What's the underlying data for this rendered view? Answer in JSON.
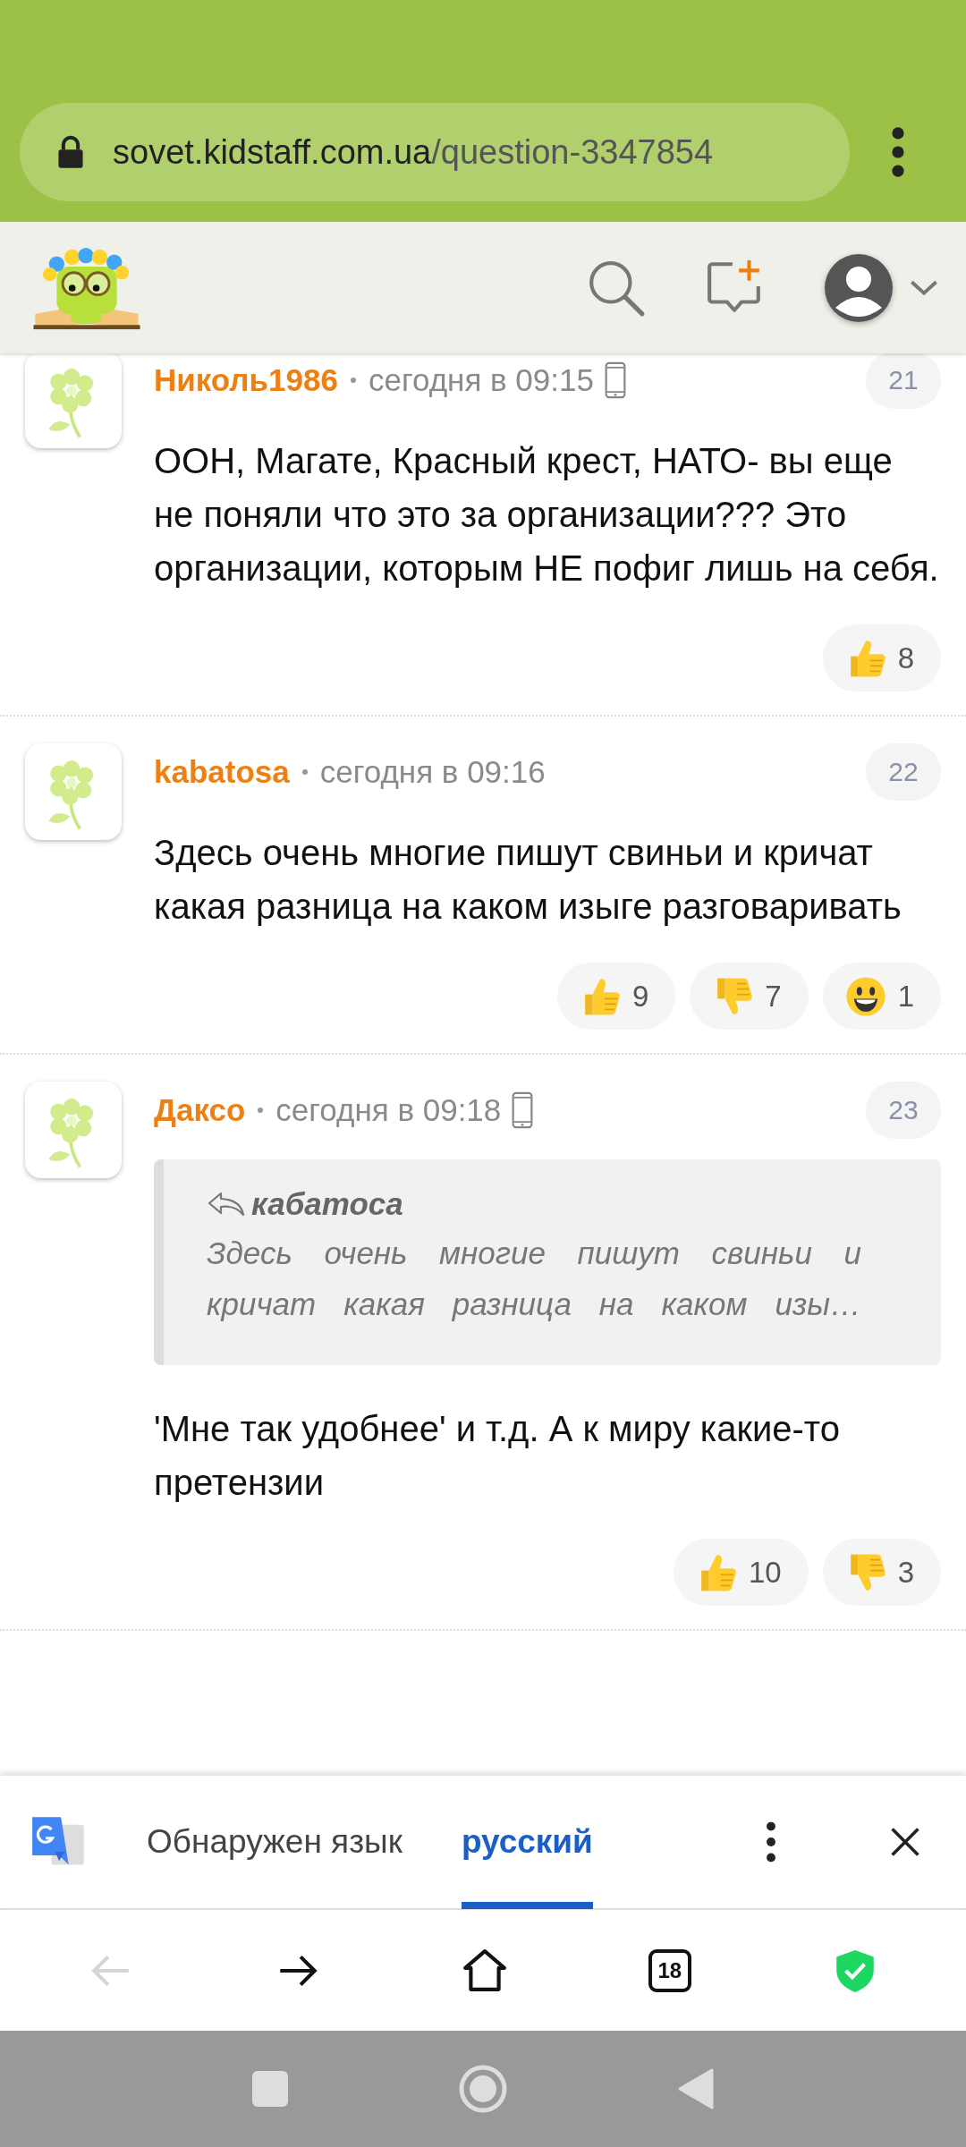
{
  "browser": {
    "url_host": "sovet.kidstaff.com.ua",
    "url_path": "/question-3347854"
  },
  "comments": [
    {
      "author": "Николь1986",
      "time": "сегодня в 09:15",
      "mobile": true,
      "number": "21",
      "text": "ООН, Магате, Красный крест, НАТО- вы еще не поняли что это за организации??? Это организации, которым НЕ пофиг лишь на себя.",
      "reactions": [
        {
          "kind": "like",
          "count": "8"
        }
      ]
    },
    {
      "author": "kabatosa",
      "time": "сегодня в 09:16",
      "mobile": false,
      "number": "22",
      "text": "Здесь очень многие пишут свиньи и кричат какая разница на каком изыге разговаривать",
      "reactions": [
        {
          "kind": "like",
          "count": "9"
        },
        {
          "kind": "dislike",
          "count": "7"
        },
        {
          "kind": "smile",
          "count": "1"
        }
      ]
    },
    {
      "author": "Даксо",
      "time": "сегодня в 09:18",
      "mobile": true,
      "number": "23",
      "quote": {
        "author": "кабатоса",
        "text": "Здесь очень многие пишут свиньи и кричат какая разница на каком изы…"
      },
      "text": "'Мне так удобнее' и т.д. А к миру какие-то претензии",
      "reactions": [
        {
          "kind": "like",
          "count": "10"
        },
        {
          "kind": "dislike",
          "count": "3"
        }
      ]
    }
  ],
  "translate_bar": {
    "tabs": [
      {
        "label": "Обнаружен язык",
        "selected": false
      },
      {
        "label": "русский",
        "selected": true
      }
    ]
  },
  "nav_buttons": [
    {
      "kind": "back",
      "disabled": true
    },
    {
      "kind": "forward",
      "disabled": false
    },
    {
      "kind": "home",
      "disabled": false
    },
    {
      "kind": "tabs",
      "label": "18",
      "disabled": false
    },
    {
      "kind": "shield",
      "disabled": false
    }
  ]
}
